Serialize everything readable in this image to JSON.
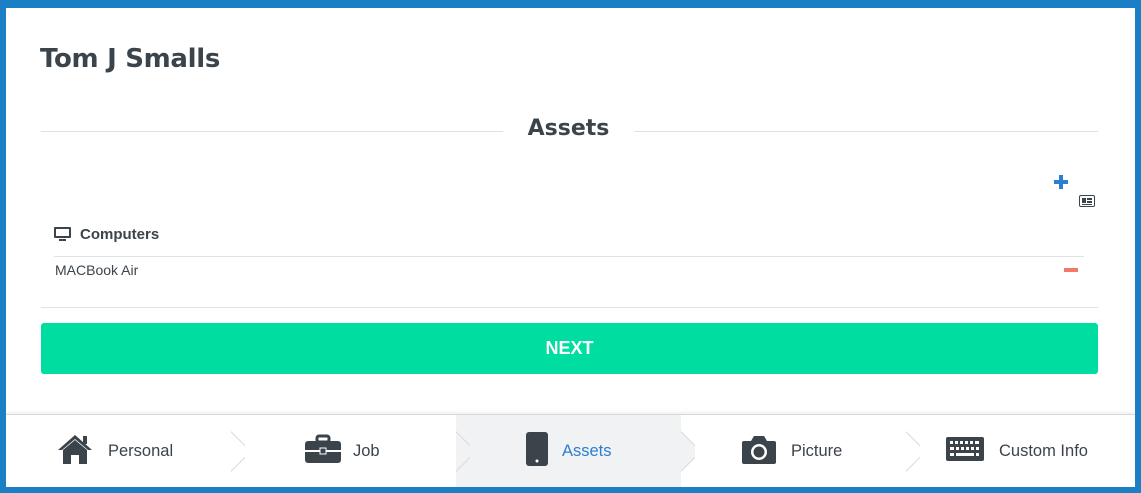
{
  "header": {
    "name": "Tom J Smalls",
    "progress_fraction": 0.6
  },
  "section": {
    "title": "Assets"
  },
  "assets": {
    "add_icon": "plus-icon",
    "card_icon": "id-card-icon",
    "groups": [
      {
        "icon": "monitor-icon",
        "label": "Computers",
        "items": [
          {
            "label": "MACBook Air",
            "remove_icon": "minus-icon"
          }
        ]
      }
    ]
  },
  "actions": {
    "next_label": "NEXT"
  },
  "tabs": [
    {
      "label": "Personal",
      "icon": "home-icon",
      "active": false
    },
    {
      "label": "Job",
      "icon": "briefcase-icon",
      "active": false
    },
    {
      "label": "Assets",
      "icon": "mobile-phone-icon",
      "active": true
    },
    {
      "label": "Picture",
      "icon": "camera-icon",
      "active": false
    },
    {
      "label": "Custom Info",
      "icon": "keyboard-icon",
      "active": false
    }
  ],
  "colors": {
    "frame_border": "#1a7fc4",
    "progress": "#d8e03a",
    "accent_blue": "#2b7fd1",
    "next_button": "#00dda0",
    "remove": "#f07a6a",
    "text": "#3b434b"
  }
}
